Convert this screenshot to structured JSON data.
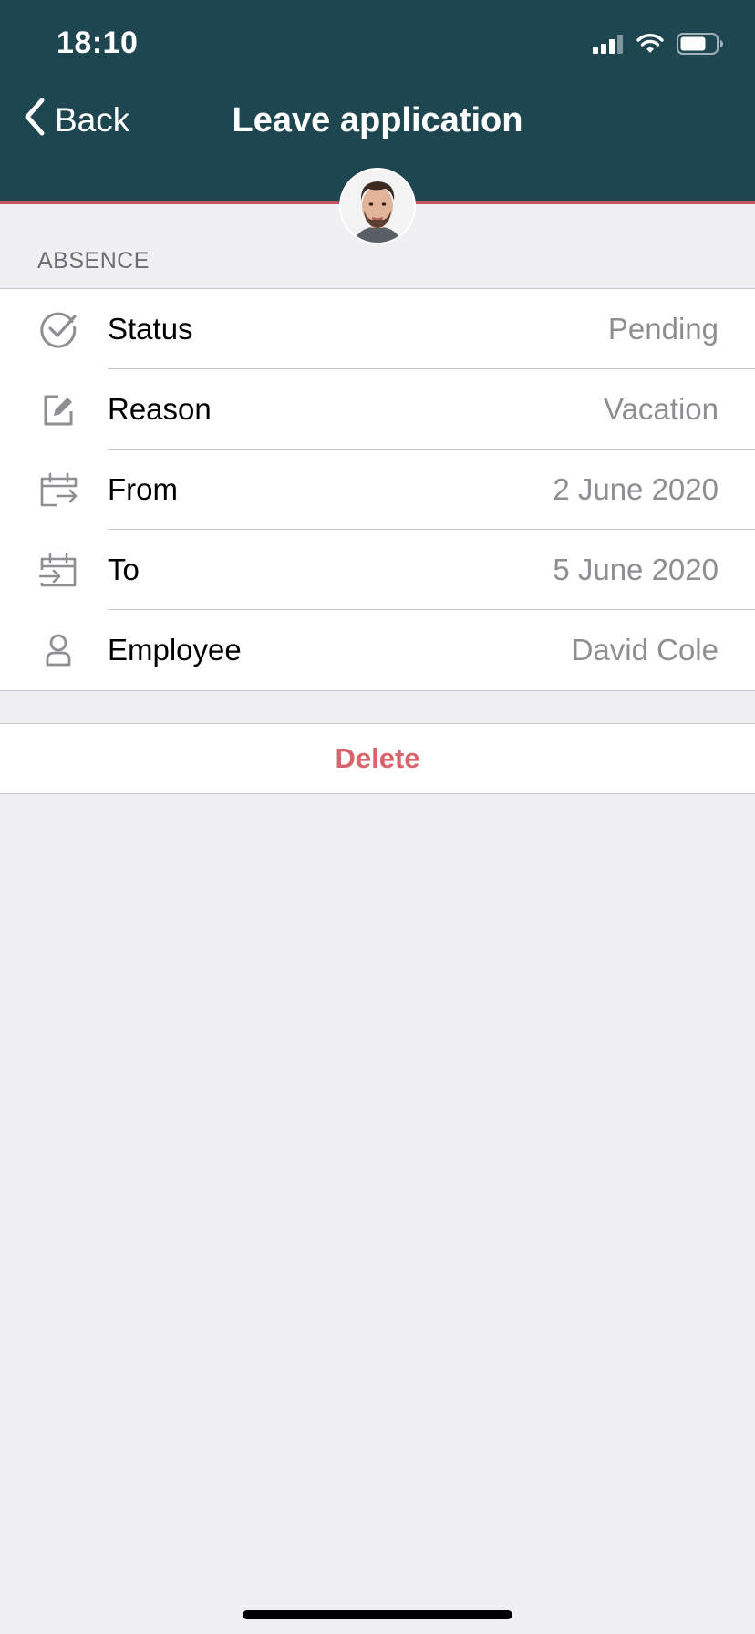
{
  "status_bar": {
    "time": "18:10",
    "icons": [
      "cellular-signal-icon",
      "wifi-icon",
      "battery-icon"
    ]
  },
  "nav": {
    "back_label": "Back",
    "title": "Leave application",
    "back_icon": "chevron-left-icon"
  },
  "avatar": {
    "icon": "user-avatar"
  },
  "section": {
    "title": "ABSENCE"
  },
  "rows": [
    {
      "icon": "check-circle-icon",
      "label": "Status",
      "value": "Pending"
    },
    {
      "icon": "edit-icon",
      "label": "Reason",
      "value": "Vacation"
    },
    {
      "icon": "calendar-from-icon",
      "label": "From",
      "value": "2 June 2020"
    },
    {
      "icon": "calendar-to-icon",
      "label": "To",
      "value": "5 June 2020"
    },
    {
      "icon": "person-icon",
      "label": "Employee",
      "value": "David Cole"
    }
  ],
  "actions": {
    "delete_label": "Delete"
  },
  "colors": {
    "header_bg": "#1e4651",
    "header_accent": "#c2585c",
    "destructive": "#d9646b",
    "secondary_text": "#8e8e93",
    "background": "#efeff4"
  }
}
